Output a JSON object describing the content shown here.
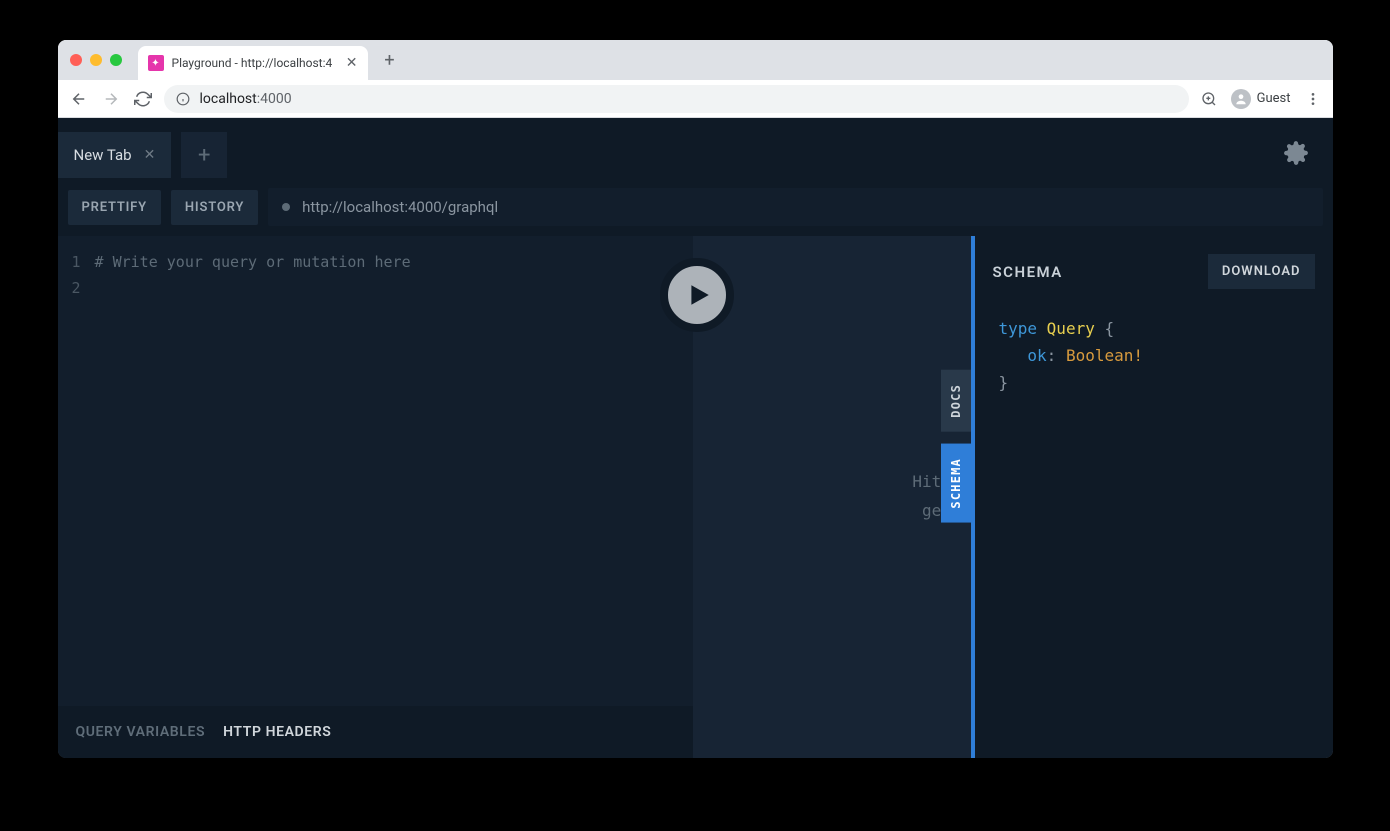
{
  "browser": {
    "tab_title": "Playground - http://localhost:4",
    "address_host": "localhost",
    "address_port": ":4000",
    "guest_label": "Guest"
  },
  "playground": {
    "tab_label": "New Tab",
    "prettify_label": "PRETTIFY",
    "history_label": "HISTORY",
    "endpoint_url": "http://localhost:4000/graphql",
    "editor_placeholder": "# Write your query or mutation here",
    "line1": "1",
    "line2": "2",
    "query_variables_label": "QUERY VARIABLES",
    "http_headers_label": "HTTP HEADERS",
    "result_hint_line1": "Hit t",
    "result_hint_line2": "get",
    "docs_tab": "DOCS",
    "schema_tab": "SCHEMA"
  },
  "schema_panel": {
    "title": "SCHEMA",
    "download_label": "DOWNLOAD",
    "kw_type": "type",
    "type_name": "Query",
    "brace_open": "{",
    "field_name": "ok",
    "colon": ":",
    "field_type": "Boolean",
    "bang": "!",
    "brace_close": "}"
  }
}
